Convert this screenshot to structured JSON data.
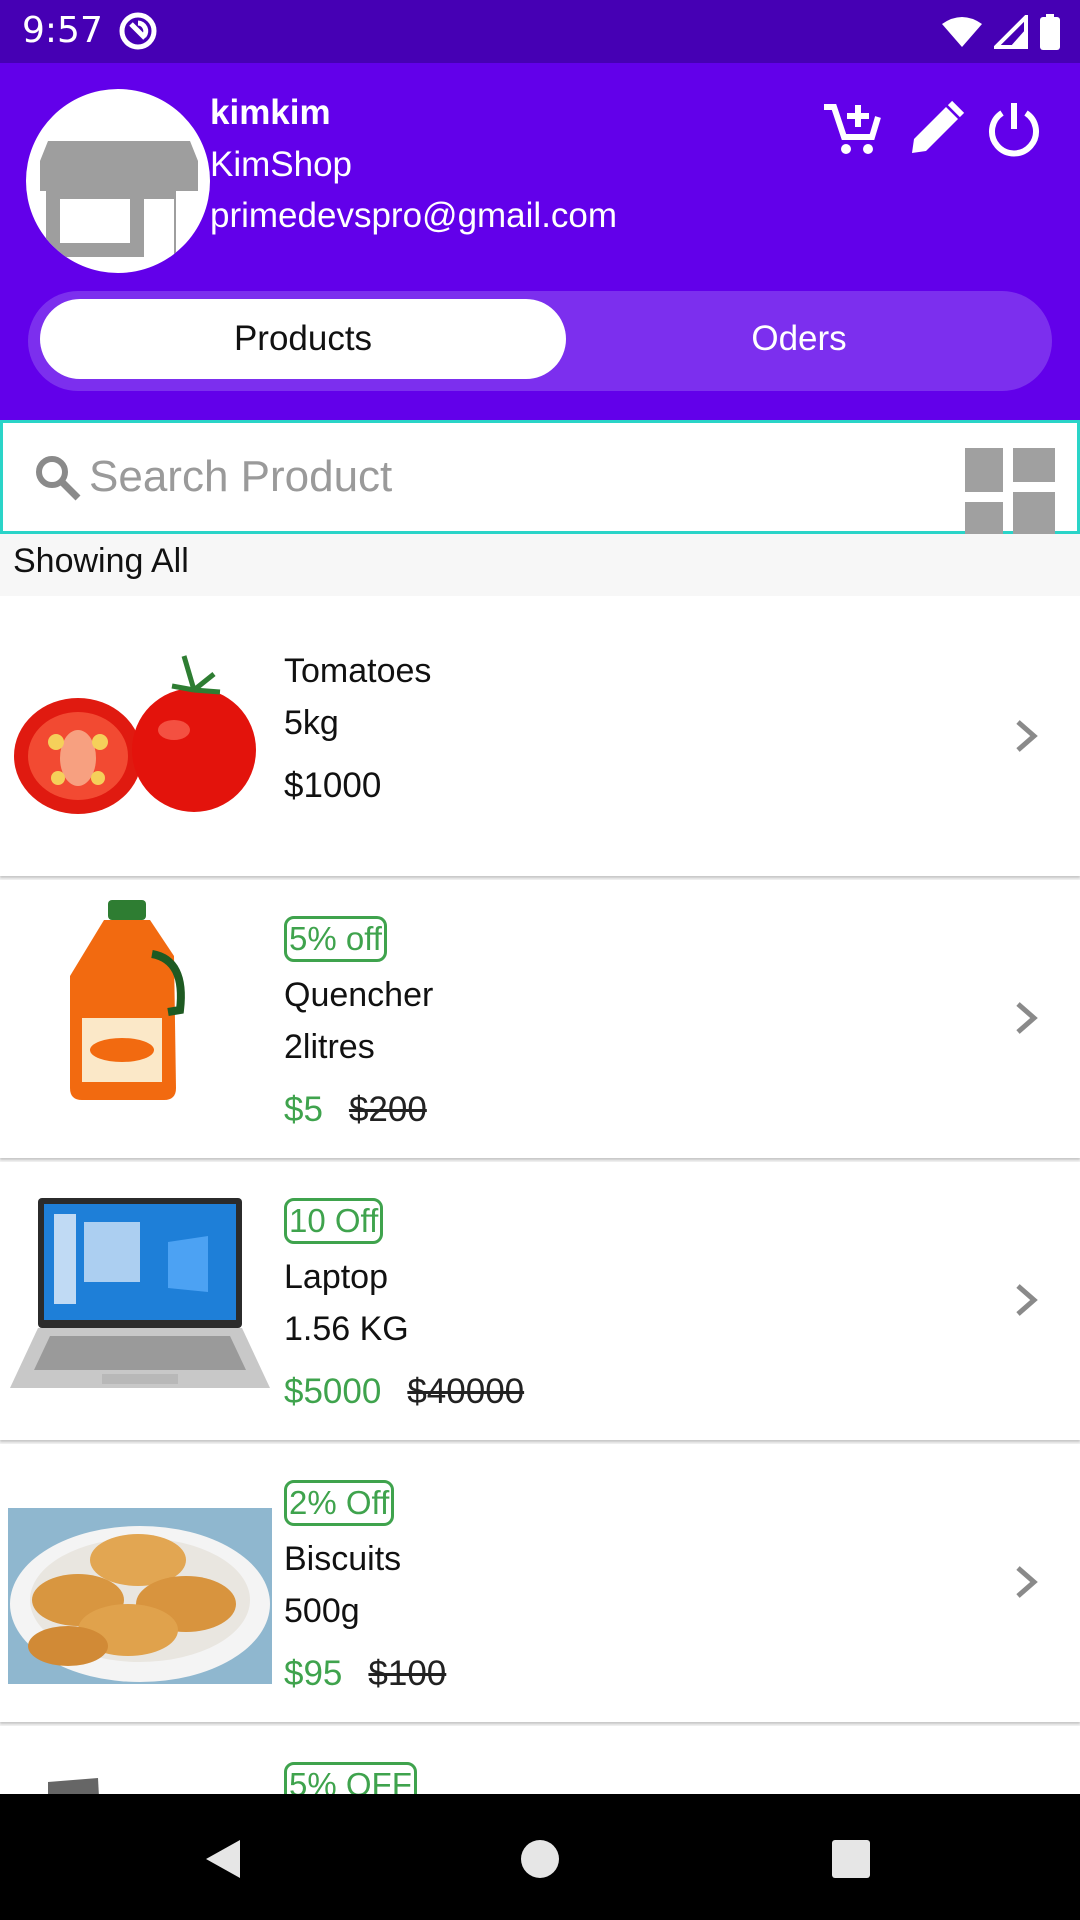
{
  "status_bar": {
    "time": "9:57"
  },
  "header": {
    "user_name": "kimkim",
    "shop_name": "KimShop",
    "email": "primedevspro@gmail.com",
    "actions": [
      "add-to-cart-icon",
      "edit-icon",
      "power-icon"
    ]
  },
  "tabs": [
    {
      "label": "Products",
      "selected": true
    },
    {
      "label": "Oders",
      "selected": false
    }
  ],
  "search": {
    "placeholder": "Search Product",
    "value": ""
  },
  "filter_label": "Showing All",
  "products": [
    {
      "name": "Tomatoes",
      "weight": "5kg",
      "price": "$1000",
      "badge": "",
      "old_price": ""
    },
    {
      "name": "Quencher",
      "weight": "2litres",
      "price": "$5",
      "badge": "5% off",
      "old_price": "$200"
    },
    {
      "name": "Laptop",
      "weight": "1.56 KG",
      "price": "$5000",
      "badge": "10 Off",
      "old_price": "$40000"
    },
    {
      "name": "Biscuits",
      "weight": "500g",
      "price": "$95",
      "badge": "2% Off",
      "old_price": "$100"
    },
    {
      "name": "",
      "weight": "",
      "price": "",
      "badge": "5% OFF",
      "old_price": ""
    }
  ],
  "colors": {
    "status_bar": "#4600b4",
    "header": "#6200ea",
    "accent_green": "#3fa34d",
    "search_border": "#2ad4c8"
  }
}
